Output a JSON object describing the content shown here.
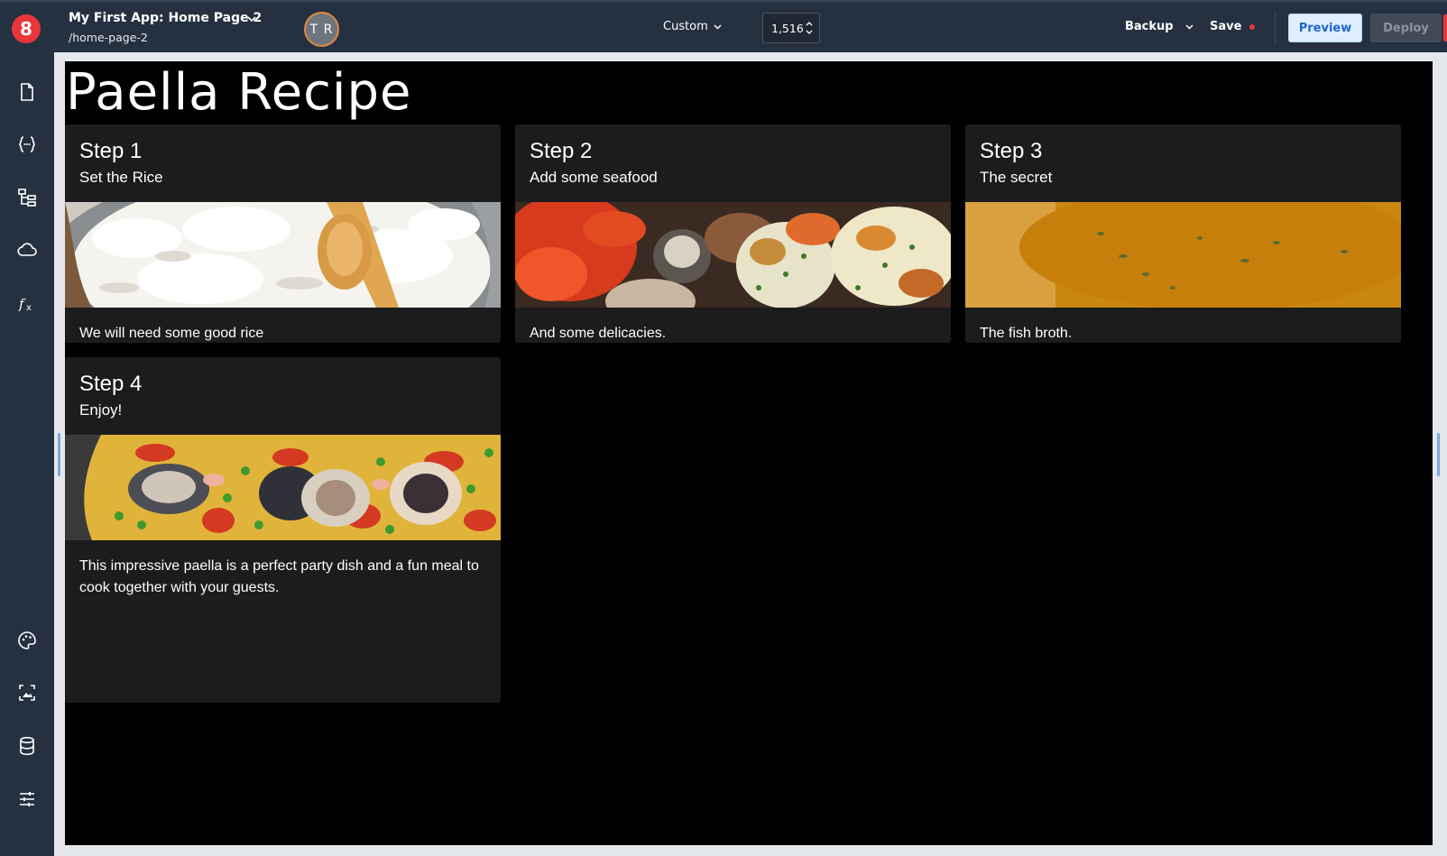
{
  "header": {
    "app_title": "My First App: Home Page 2",
    "route": "/home-page-2",
    "avatar_initials": "T R",
    "device_label": "Custom",
    "width_value": "1,516",
    "backup_label": "Backup",
    "save_label": "Save",
    "preview_label": "Preview",
    "deploy_label": "Deploy"
  },
  "sidebar": {
    "top_icons": [
      "page-icon",
      "variables-icon",
      "component-tree-icon",
      "cloud-icon",
      "function-icon"
    ],
    "bottom_icons": [
      "palette-icon",
      "assets-icon",
      "database-icon",
      "settings-sliders-icon"
    ]
  },
  "canvas": {
    "title": "Paella Recipe",
    "cards": [
      {
        "step": "Step 1",
        "subtitle": "Set the Rice",
        "text": "We will need some good rice",
        "image": "rice-bowl-image"
      },
      {
        "step": "Step 2",
        "subtitle": "Add some seafood",
        "text": "And some delicacies.",
        "image": "seafood-platter-image"
      },
      {
        "step": "Step 3",
        "subtitle": "The secret",
        "text": "The fish broth.",
        "image": "fish-broth-image"
      },
      {
        "step": "Step 4",
        "subtitle": "Enjoy!",
        "text": "This impressive paella is a perfect party dish and a fun meal to cook together with your guests.",
        "image": "paella-image"
      }
    ]
  },
  "colors": {
    "brand": "#e8363a",
    "chrome": "#253140",
    "canvas_bg": "#000000",
    "card_bg": "#1c1b1d",
    "preview_accent": "#1f66c9"
  }
}
